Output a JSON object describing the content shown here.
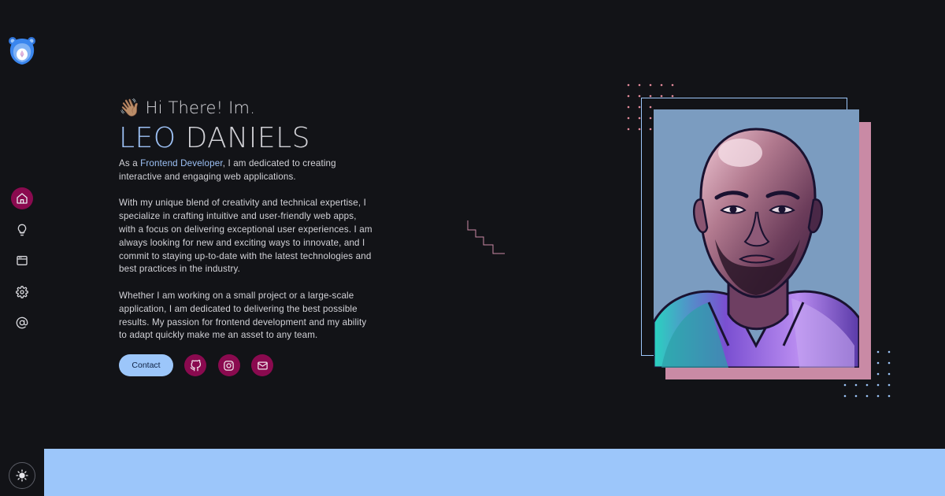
{
  "hero": {
    "wave_emoji": "👋🏽",
    "greeting": "Hi There! Im.",
    "first_name": "LEO",
    "last_name": "DANIELS",
    "intro_before": "As a ",
    "intro_role": "Frontend Developer",
    "intro_after": ", I am dedicated to creating interactive and engaging web applications.",
    "paragraph_2": "With my unique blend of creativity and technical expertise, I specialize in crafting intuitive and user-friendly web apps, with a focus on delivering exceptional user experiences. I am always looking for new and exciting ways to innovate, and I commit to staying up-to-date with the latest technologies and best practices in the industry.",
    "paragraph_3": "Whether I am working on a small project or a large-scale application, I am dedicated to delivering the best possible results. My passion for frontend development and my ability to adapt quickly make me an asset to any team."
  },
  "actions": {
    "contact_label": "Contact",
    "social_icons": [
      "github-icon",
      "instagram-icon",
      "mail-icon"
    ]
  },
  "sidebar": {
    "logo_icon": "bear-logo-icon",
    "nav_icons": [
      "home-icon",
      "lightbulb-icon",
      "browser-window-icon",
      "gear-icon",
      "at-sign-icon"
    ],
    "active_item": "home-icon",
    "theme_toggle_icon": "sun-icon"
  },
  "colors": {
    "background": "#121317",
    "accent_blue": "#9cc6fa",
    "accent_magenta": "#8a0a4f",
    "accent_pink": "#c98aa5"
  }
}
